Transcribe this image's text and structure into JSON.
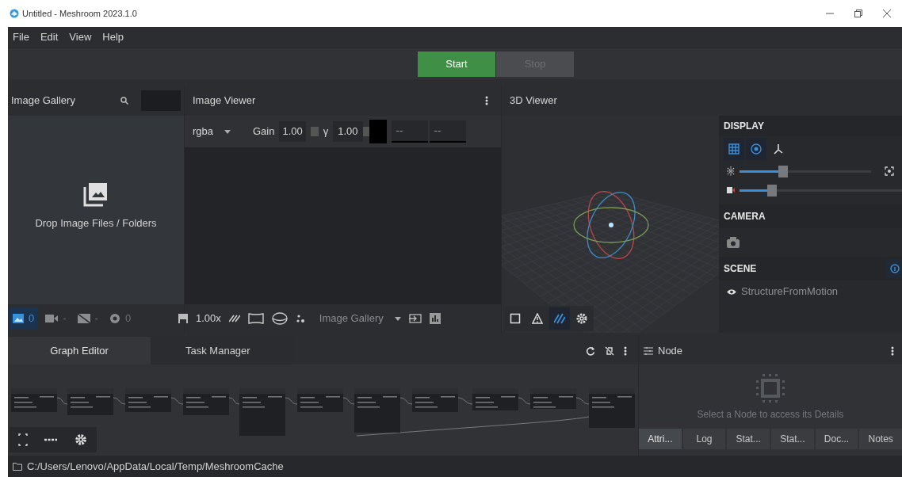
{
  "window": {
    "title": "Untitled - Meshroom 2023.1.0"
  },
  "menu": [
    "File",
    "Edit",
    "View",
    "Help"
  ],
  "toolbar": {
    "buttons": [
      {
        "label": "Start",
        "disabled": false
      },
      {
        "label": "Stop",
        "disabled": true
      }
    ]
  },
  "image_gallery": {
    "title": "Image Gallery",
    "drop_hint": "Drop Image Files / Folders",
    "filters": [
      {
        "kind": "images",
        "count": "0",
        "selected": true
      },
      {
        "kind": "cameras",
        "count": "-",
        "selected": false
      },
      {
        "kind": "rejected",
        "count": "-",
        "selected": false
      },
      {
        "kind": "intrinsics",
        "count": "0",
        "selected": false
      }
    ]
  },
  "image_viewer": {
    "title": "Image Viewer",
    "channel": "rgba",
    "gain_label": "Gain",
    "gain": "1.00",
    "gamma_label": "γ",
    "gamma": "1.00",
    "fields": [
      "--",
      "--"
    ],
    "zoom": "1.00x",
    "source": "Image Gallery"
  },
  "viewer_3d": {
    "title": "3D Viewer",
    "display_title": "DISPLAY",
    "toggles": [
      {
        "kind": "grid",
        "selected": true
      },
      {
        "kind": "origin",
        "selected": true
      },
      {
        "kind": "axes",
        "selected": false
      }
    ],
    "sliders": [
      {
        "kind": "points",
        "level": 0.33
      },
      {
        "kind": "cameras",
        "level": 0.2
      }
    ],
    "camera_title": "CAMERA",
    "scene_title": "SCENE",
    "scene_items": [
      {
        "label": "StructureFromMotion",
        "visible": true
      }
    ],
    "tools": [
      {
        "kind": "square",
        "selected": false
      },
      {
        "kind": "warning",
        "selected": false
      },
      {
        "kind": "hatch",
        "selected": true
      },
      {
        "kind": "gear",
        "selected": false
      }
    ]
  },
  "bottom_tabs": [
    {
      "label": "Graph Editor",
      "selected": true
    },
    {
      "label": "Task Manager",
      "selected": false
    }
  ],
  "node_panel": {
    "title": "Node",
    "hint": "Select a Node to access its Details",
    "tabs": [
      {
        "label": "Attri...",
        "selected": true
      },
      {
        "label": "Log",
        "selected": false
      },
      {
        "label": "Stat...",
        "selected": false
      },
      {
        "label": "Stat...",
        "selected": false
      },
      {
        "label": "Doc...",
        "selected": false
      },
      {
        "label": "Notes",
        "selected": false
      }
    ]
  },
  "status_bar": {
    "path": "C:/Users/Lenovo/AppData/Local/Temp/MeshroomCache"
  }
}
